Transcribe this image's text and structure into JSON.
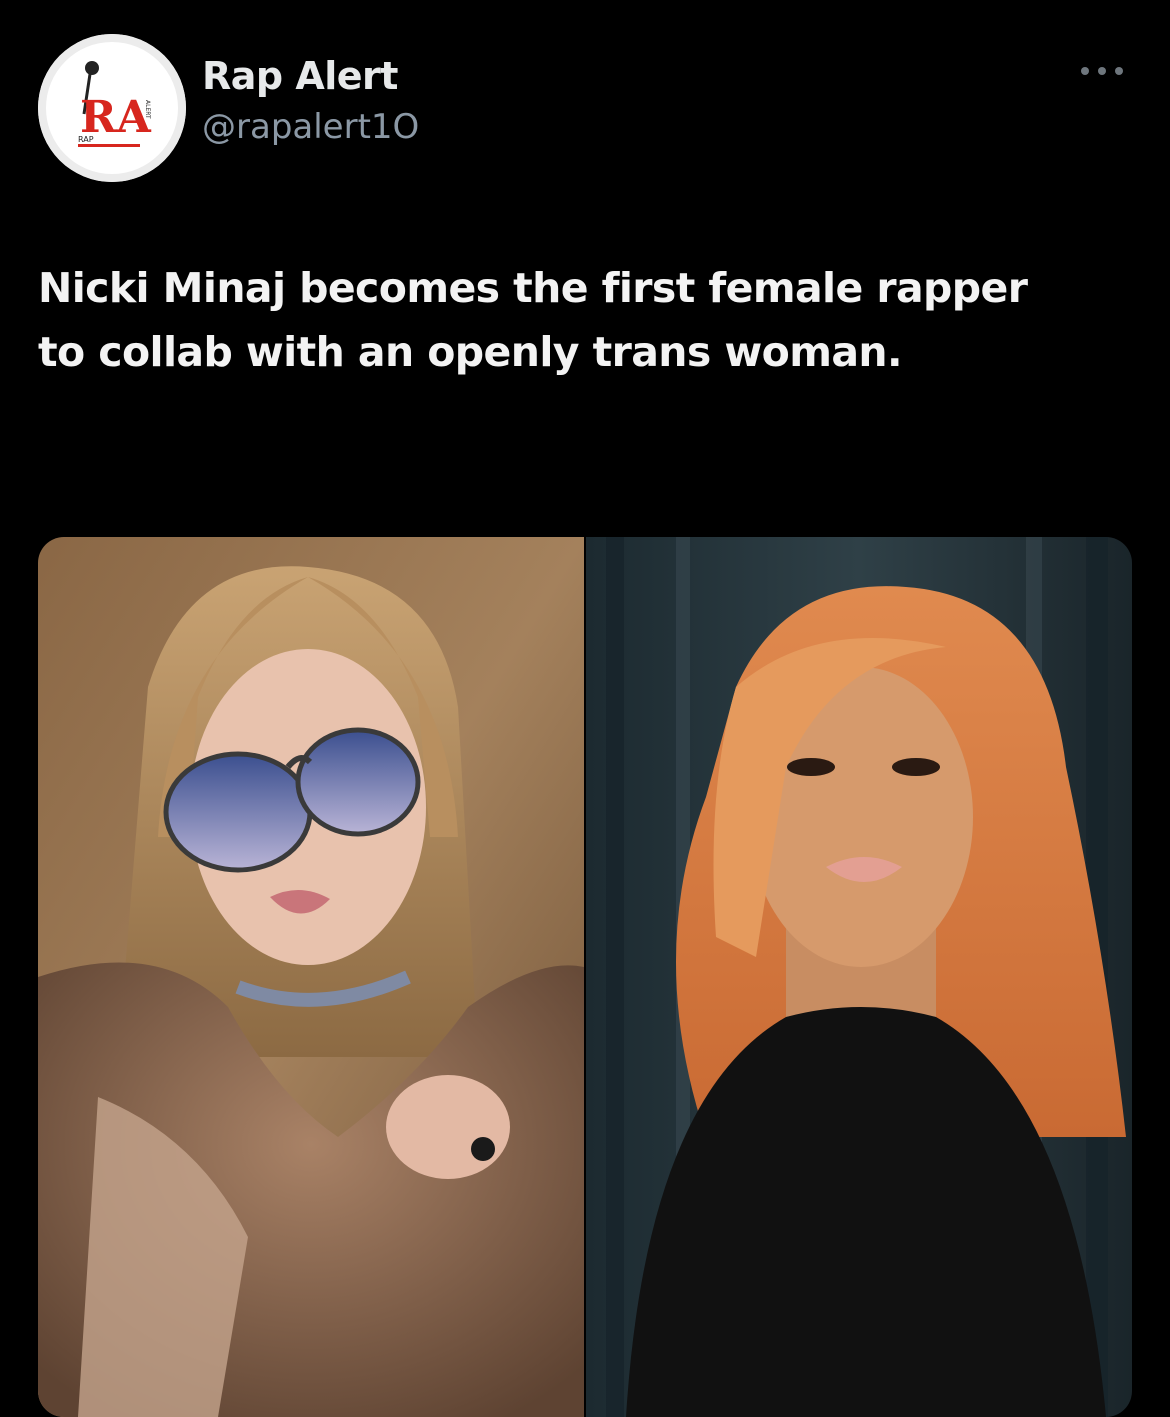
{
  "post": {
    "author": {
      "display_name": "Rap Alert",
      "handle": "@rapalert1O",
      "avatar_logo_text": "RA",
      "avatar_small_text": "RAP",
      "avatar_side_text": "ALERT"
    },
    "more_icon": "more-horizontal-icon",
    "text": "Nicki Minaj becomes the first female rapper to collab with an openly trans woman.",
    "media": [
      {
        "kind": "photo",
        "subject": "blonde woman in aviator sunglasses and fur coat, warm brown backdrop"
      },
      {
        "kind": "photo",
        "subject": "woman with voluminous orange hair in black turtleneck, dark curtain backdrop"
      }
    ]
  },
  "colors": {
    "background": "#000000",
    "text_primary": "#e7e9ea",
    "text_secondary": "#8b98a5",
    "brand_red": "#d7261e"
  }
}
